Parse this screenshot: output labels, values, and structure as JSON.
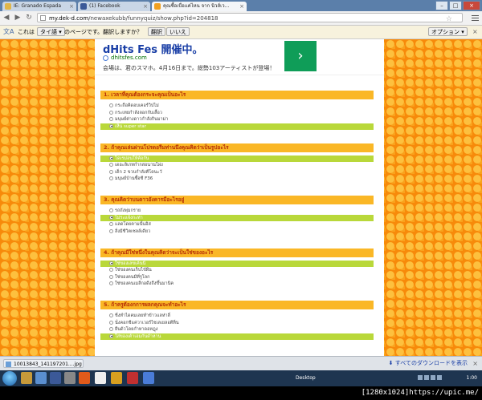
{
  "browser": {
    "tabs": [
      {
        "label": "IE: Granado Espada",
        "active": false,
        "color": "#e0b64a"
      },
      {
        "label": "(1) Facebook",
        "active": false,
        "color": "#3b5998"
      },
      {
        "label": "คุณซื้อเบื่อแค่ไหน จาก นิวส์เว...",
        "active": true,
        "color": "#f0a020"
      }
    ],
    "url_host": "my.dek-d.com",
    "url_path": "/newaxekubb/funnyquiz/show.php?id=204818"
  },
  "translate_bar": {
    "prefix": "これは",
    "language": "タイ語",
    "message": "のページです。翻訳しますか？",
    "translate_label": "翻訳",
    "no_label": "いいえ",
    "options_label": "オプション"
  },
  "ad": {
    "title": "dHits Fes 開催中。",
    "domain": "dhitsfes.com",
    "description": "会場は、君のスマホ。4月16日まで。総勢103アーティストが登場！",
    "go_arrow": "›"
  },
  "questions": [
    {
      "title": "1.  เวลาที่คุณต้องกระจะคุณเป็นอะไร",
      "options": [
        "กระถือคิดอบเคอร์วิปไม่",
        "กระเทยกำลังลอกกับเสื้อว",
        "มนุษย์ต่างดาวกำลังกินมาม่า",
        "เห็น super star"
      ],
      "selected": 3
    },
    {
      "title": "2.  ถ้าคุณเล่นผ่านโปรดอรีมท่านนึงคุณคิดว่าเป็นรูปอะไร",
      "options": [
        "โดเรม่อนให้ค้อกัน",
        "เดอะลิเกทกำกสอนานโผ่ง",
        "เด็ก 2 ขวบกำลังคีโดนะวั",
        "มนุษย์บ้านซื้อซี F36"
      ],
      "selected": 0
    },
    {
      "title": "3.  คุณคิดว่าบนดาวอังคารมีอะไรอยู่",
      "options": [
        "รถถังพุ่มกราย",
        "ไม่ระแจ้งกะท่า",
        "แลดโดยคามนั้นอิส",
        "สิ่งมีชีวิตเซลล์เดียว"
      ],
      "selected": 1
    },
    {
      "title": "4.  ถ้าคุณมีใช่หนึ่งในคุณคิดว่าจะเป็นใช่ของอะไร",
      "options": [
        "ใช่ของเลขเค้นนี่",
        "ใช่ของคนเก็บไข้ผืน",
        "ใช่ของคนมีที่รูโลก",
        "ใช่ของคนเมลีกอดีงถึงขึ้นมานิค"
      ],
      "selected": 0
    },
    {
      "title": "5.  ถ้าครูต้องกการผลกคุณจะทำอะไร",
      "options": [
        "ชิ่งทำไดคมเลยทำข้าวแลห่าลี่",
        "นั่งคอกชีแค่วาเวอร์ไซเลเยลอตีท็น",
        "ยืนด้วโดยกำหาดอหฎุง",
        "ใส่ของเต้าเอมกันดำหาน"
      ],
      "selected": 3
    }
  ],
  "download_bar": {
    "file": "10013843_141197201....jpg",
    "show_all": "すべてのダウンロードを表示"
  },
  "taskbar": {
    "desktop_label": "Desktop",
    "clock": "1:00"
  },
  "watermark": "[1280x1024]https://upic.me/"
}
